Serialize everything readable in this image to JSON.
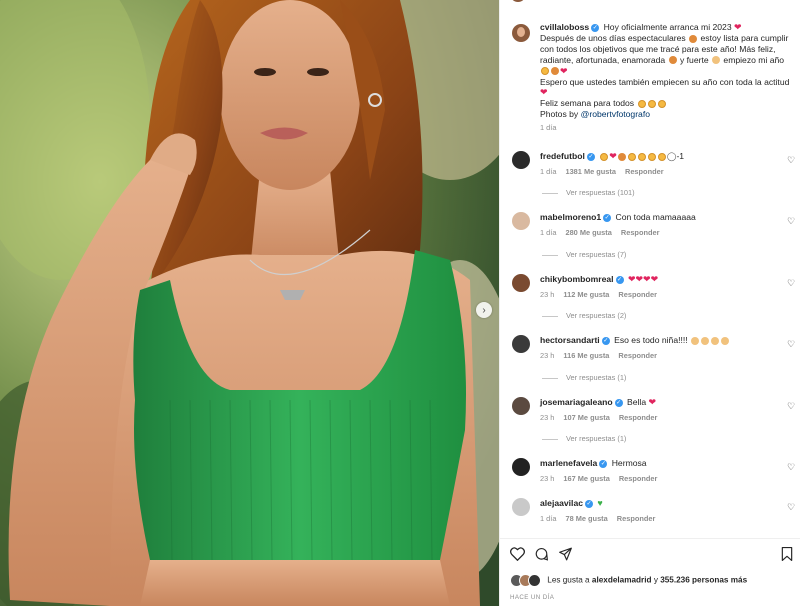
{
  "post": {
    "author": "cvillaloboss",
    "caption_lines": [
      "Hoy oficialmente arranca mi 2023",
      "Después de unos días espectaculares",
      "estoy lista para cumplir con todos los objetivos que me tracé para este año! Más feliz, radiante, afortunada, enamorada",
      "y fuerte",
      "empiezo mi año",
      "Espero que ustedes también empiecen su año con toda la actitud",
      "Feliz semana para todos",
      "Photos by"
    ],
    "photo_credit": "@robertvfotografo",
    "time": "1 día"
  },
  "comments": [
    {
      "user": "fredefutbol",
      "verified": true,
      "text": "-1",
      "time": "1 día",
      "likes": "1381 Me gusta",
      "reply": "Responder",
      "replies": "Ver respuestas (101)"
    },
    {
      "user": "mabelmoreno1",
      "verified": true,
      "text": "Con toda mamaaaaa",
      "time": "1 día",
      "likes": "280 Me gusta",
      "reply": "Responder",
      "replies": "Ver respuestas (7)"
    },
    {
      "user": "chikybombomreal",
      "verified": true,
      "text": "",
      "time": "23 h",
      "likes": "112 Me gusta",
      "reply": "Responder",
      "replies": "Ver respuestas (2)"
    },
    {
      "user": "hectorsandarti",
      "verified": true,
      "text": "Eso es todo niña!!!!",
      "time": "23 h",
      "likes": "116 Me gusta",
      "reply": "Responder",
      "replies": "Ver respuestas (1)"
    },
    {
      "user": "josemariagaleano",
      "verified": true,
      "text": "Bella",
      "time": "23 h",
      "likes": "107 Me gusta",
      "reply": "Responder",
      "replies": "Ver respuestas (1)"
    },
    {
      "user": "marlenefavela",
      "verified": true,
      "text": "Hermosa",
      "time": "23 h",
      "likes": "167 Me gusta",
      "reply": "Responder",
      "replies": ""
    },
    {
      "user": "alejaavilac",
      "verified": true,
      "text": "",
      "time": "1 día",
      "likes": "78 Me gusta",
      "reply": "Responder",
      "replies": ""
    }
  ],
  "footer": {
    "likes_prefix": "Les gusta a",
    "likes_user": "alexdelamadrid",
    "likes_mid": "y",
    "likes_count": "355.236 personas más",
    "time_ago": "HACE UN DÍA"
  },
  "icons": {
    "like": "heart-icon",
    "comment": "comment-icon",
    "share": "share-icon",
    "save": "bookmark-icon",
    "next": "chevron-right-icon"
  },
  "colors": {
    "verified": "#3897f0",
    "heart": "#e0245e",
    "top_green": "#2fa84f"
  }
}
